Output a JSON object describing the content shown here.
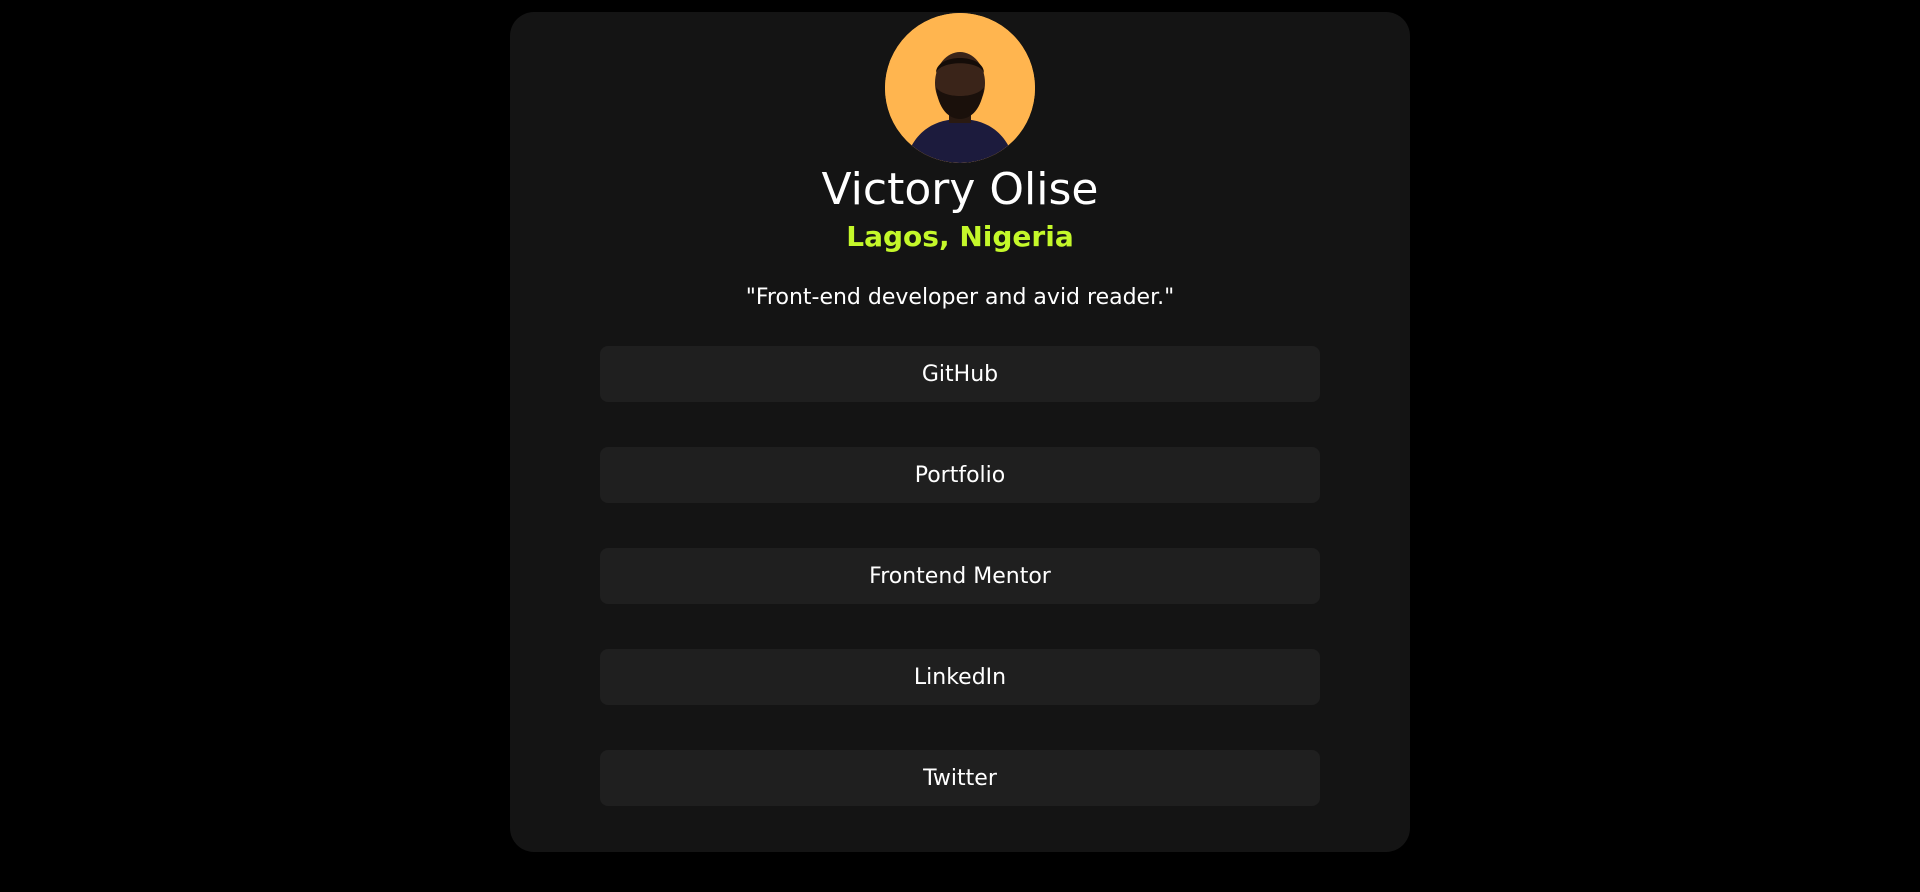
{
  "profile": {
    "name": "Victory Olise",
    "location": "Lagos, Nigeria",
    "bio": "\"Front-end developer and avid reader.\""
  },
  "links": [
    {
      "label": "GitHub"
    },
    {
      "label": "Portfolio"
    },
    {
      "label": "Frontend Mentor"
    },
    {
      "label": "LinkedIn"
    },
    {
      "label": "Twitter"
    }
  ],
  "colors": {
    "page_background": "#000000",
    "card_background": "#141414",
    "button_background": "#1f1f1f",
    "accent": "#c4f82a",
    "avatar_background": "#ffb54f",
    "text": "#ffffff"
  }
}
